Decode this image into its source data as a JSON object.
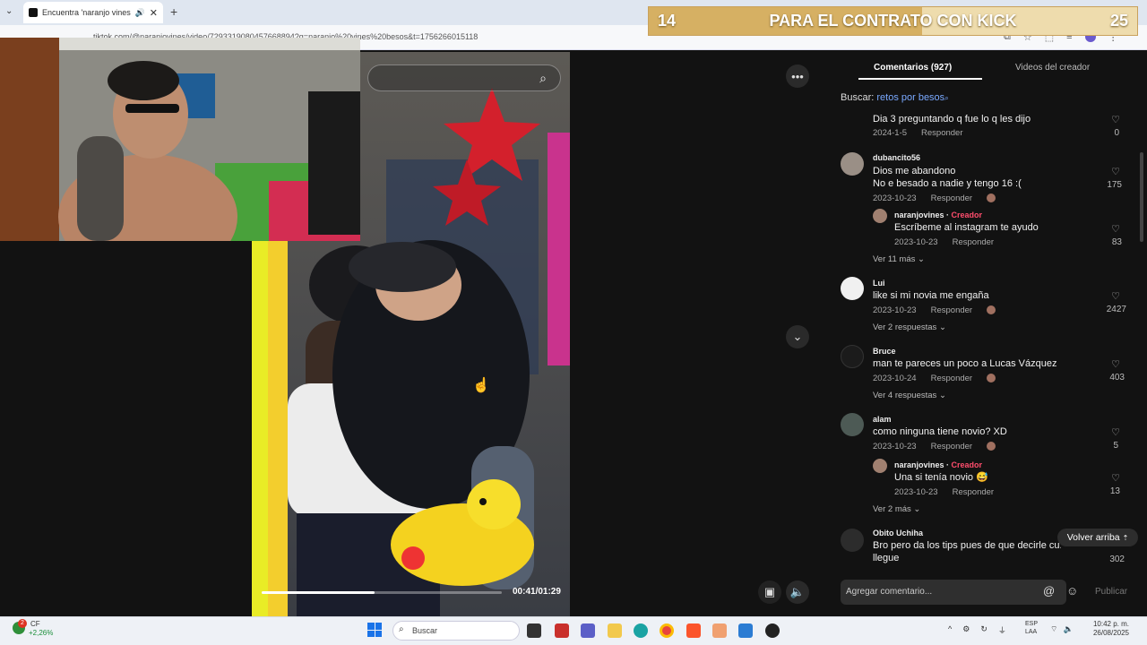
{
  "browser": {
    "tab_title": "Encuentra 'naranjo vines' be",
    "url": "tiktok.com/@naranjovines/video/7293319080457668894?q=naranjo%20vines%20besos&t=1756266015118"
  },
  "overlay": {
    "left_value": "14",
    "text": "PARA EL CONTRATO CON KICK",
    "right_value": "25",
    "progress_fraction": 0.56
  },
  "video": {
    "time": "00:41/01:29",
    "progress_fraction": 0.47,
    "more_icon": "ellipsis-icon",
    "down_icon": "chevron-down-icon"
  },
  "panel": {
    "tab_comments": "Comentarios (927)",
    "tab_videos": "Videos del creador",
    "search_label": "Buscar:",
    "search_query": "retos por besos",
    "comments": [
      {
        "id": "c0",
        "user": "",
        "text": "Dia 3 preguntando q fue lo q les dijo",
        "date": "2024-1-5",
        "reply": "Responder",
        "likes": "0"
      },
      {
        "id": "c1",
        "user": "dubancito56",
        "text": "Dios me abandono\nNo e besado a nadie y tengo 16 :(",
        "date": "2023-10-23",
        "reply": "Responder",
        "likes": "175",
        "subreply": {
          "user": "naranjovines",
          "creator": "Creador",
          "text": "Escríbeme al instagram te ayudo",
          "date": "2023-10-23",
          "reply": "Responder",
          "likes": "83"
        },
        "more": "Ver 11 más"
      },
      {
        "id": "c2",
        "user": "Lui",
        "text": "like si mi novia me engaña",
        "date": "2023-10-23",
        "reply": "Responder",
        "likes": "2427",
        "more": "Ver 2 respuestas"
      },
      {
        "id": "c3",
        "user": "Bruce",
        "text": "man te pareces un poco a Lucas Vázquez",
        "date": "2023-10-24",
        "reply": "Responder",
        "likes": "403",
        "more": "Ver 4 respuestas"
      },
      {
        "id": "c4",
        "user": "alam",
        "text": "como ninguna tiene novio? XD",
        "date": "2023-10-23",
        "reply": "Responder",
        "likes": "5",
        "subreply": {
          "user": "naranjovines",
          "creator": "Creador",
          "text": "Una si tenía novio 😅",
          "date": "2023-10-23",
          "reply": "Responder",
          "likes": "13"
        },
        "more": "Ver 2 más"
      },
      {
        "id": "c5",
        "user": "Obito Uchiha",
        "text": "Bro pero da los tips pues de que decirle cu...\nllegue",
        "likes": "302"
      }
    ],
    "back_to_top": "Volver arriba",
    "compose_placeholder": "Agregar comentario...",
    "publish": "Publicar"
  },
  "taskbar": {
    "weather_temp": "CF",
    "weather_change": "+2,26%",
    "notification_count": "2",
    "search_placeholder": "Buscar",
    "lang_1": "ESP",
    "lang_2": "LAA",
    "time": "10:42 p. m.",
    "date": "26/08/2025"
  }
}
